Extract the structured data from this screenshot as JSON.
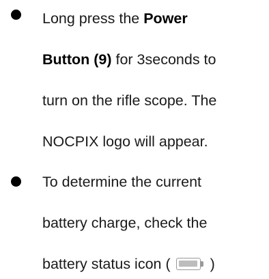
{
  "bullets": [
    {
      "lines": [
        {
          "pre": "Long press the ",
          "bold": "Power",
          "post": ""
        },
        {
          "pre": "",
          "bold": "Button (9)",
          "post": " for 3seconds to"
        },
        {
          "pre": "turn on the rifle scope. The",
          "bold": "",
          "post": ""
        },
        {
          "pre": "NOCPIX logo will appear.",
          "bold": "",
          "post": ""
        }
      ]
    },
    {
      "lines": [
        {
          "pre": "To determine the current"
        },
        {
          "pre": "battery charge, check the"
        },
        {
          "pre": "battery status icon (",
          "post": ")"
        }
      ]
    }
  ],
  "icons": {
    "battery": "battery-full-icon"
  },
  "colors": {
    "text": "#1a1a1a",
    "bullet": "#000000",
    "battery_outline": "#999999",
    "battery_fill": "#bdbdbd"
  }
}
